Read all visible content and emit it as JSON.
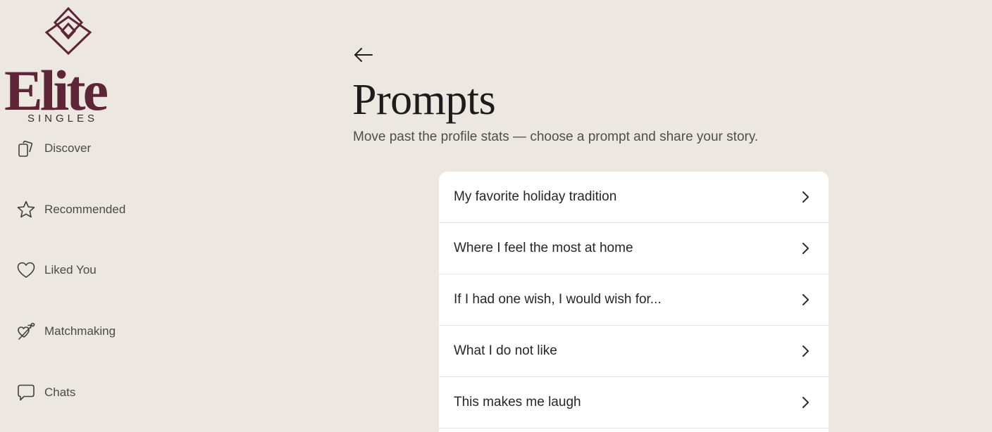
{
  "brand": {
    "name": "Elite",
    "tagline": "SINGLES",
    "color": "#5E2538"
  },
  "sidebar": {
    "items": [
      {
        "label": "Discover",
        "icon": "discover-cards-icon"
      },
      {
        "label": "Recommended",
        "icon": "star-icon"
      },
      {
        "label": "Liked You",
        "icon": "heart-icon"
      },
      {
        "label": "Matchmaking",
        "icon": "cupid-arrow-icon"
      },
      {
        "label": "Chats",
        "icon": "chat-bubble-icon"
      }
    ]
  },
  "main": {
    "back_icon": "arrow-left-icon",
    "title": "Prompts",
    "subtitle": "Move past the profile stats — choose a prompt and share your story.",
    "prompts": [
      {
        "label": "My favorite holiday tradition"
      },
      {
        "label": "Where I feel the most at home"
      },
      {
        "label": "If I had one wish, I would wish for..."
      },
      {
        "label": "What I do not like"
      },
      {
        "label": "This makes me laugh"
      }
    ]
  },
  "colors": {
    "background": "#ECE7E1",
    "card": "#FFFFFF",
    "text": "#262626"
  }
}
